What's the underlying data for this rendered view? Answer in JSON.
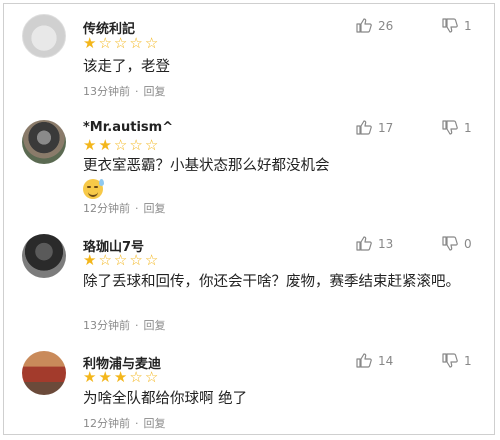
{
  "comments": [
    {
      "username": "传统利記",
      "rating": 1,
      "text": "该走了，老登",
      "time": "13分钟前",
      "reply_label": "回复",
      "likes": "26",
      "dislikes": "1"
    },
    {
      "username": "*Mr.autism^",
      "rating": 2,
      "text": "更衣室恶霸？小基状态那么好都没机会",
      "time": "12分钟前",
      "reply_label": "回复",
      "likes": "17",
      "dislikes": "1"
    },
    {
      "username": "珞珈山7号",
      "rating": 1,
      "text": "除了丢球和回传，你还会干啥？废物，赛季结束赶紧滚吧。",
      "time": "13分钟前",
      "reply_label": "回复",
      "likes": "13",
      "dislikes": "0"
    },
    {
      "username": "利物浦与麦迪",
      "rating": 3,
      "text": "为啥全队都给你球啊 绝了",
      "time": "12分钟前",
      "reply_label": "回复",
      "likes": "14",
      "dislikes": "1"
    }
  ],
  "colors": {
    "star": "#f3b61b",
    "meta": "#8a8a8a"
  },
  "icons": {
    "like": "thumbs-up-icon",
    "dislike": "thumbs-down-icon",
    "emoji": "sweat-smile-emoji"
  }
}
